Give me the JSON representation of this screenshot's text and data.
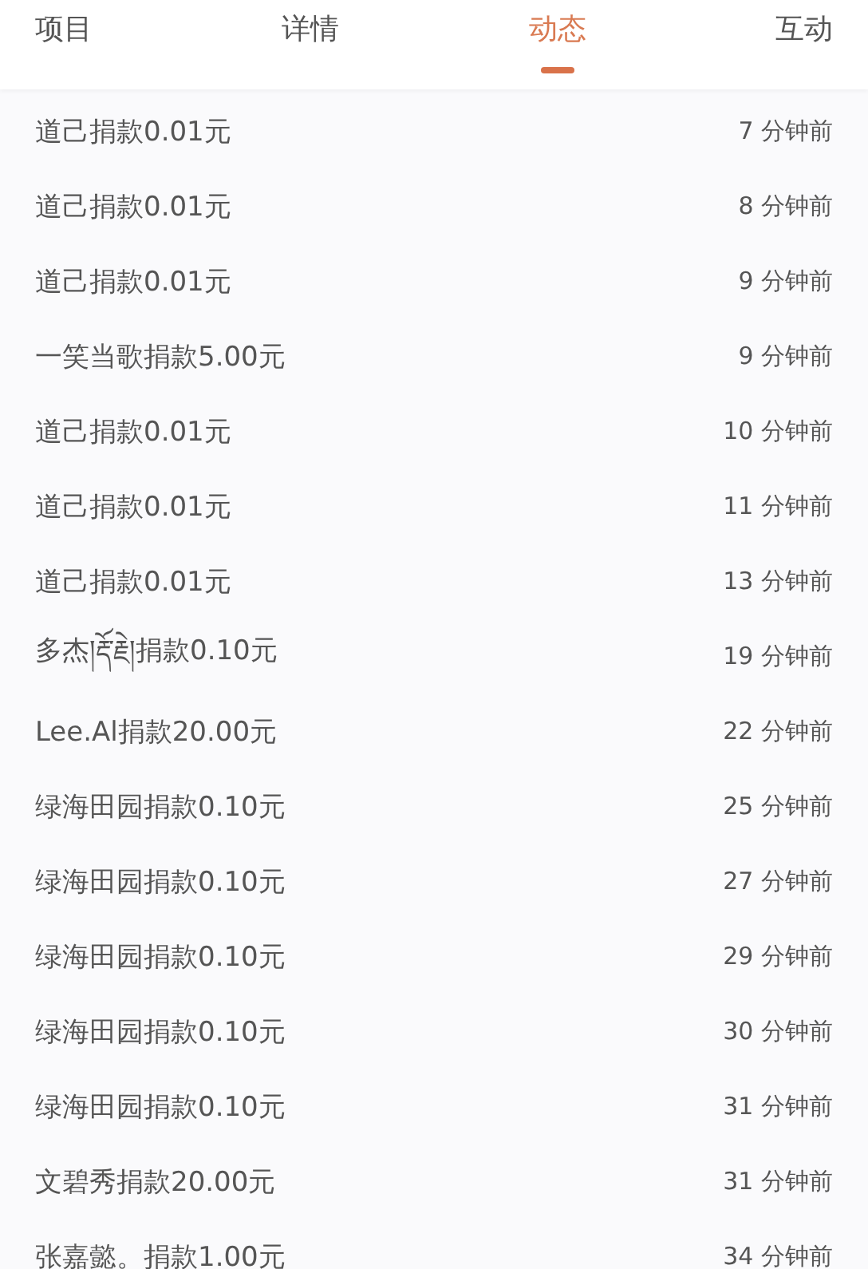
{
  "tabs": [
    {
      "label": "项目",
      "selected": false
    },
    {
      "label": "详情",
      "selected": false
    },
    {
      "label": "动态",
      "selected": true
    },
    {
      "label": "互动",
      "selected": false
    }
  ],
  "feed": [
    {
      "text": "道己捐款0.01元",
      "time": "7 分钟前"
    },
    {
      "text": "道己捐款0.01元",
      "time": "8 分钟前"
    },
    {
      "text": "道己捐款0.01元",
      "time": "9 分钟前"
    },
    {
      "text": "一笑当歌捐款5.00元",
      "time": "9 分钟前"
    },
    {
      "text": "道己捐款0.01元",
      "time": "10 分钟前"
    },
    {
      "text": "道己捐款0.01元",
      "time": "11 分钟前"
    },
    {
      "text": "道己捐款0.01元",
      "time": "13 分钟前"
    },
    {
      "text": "多杰།རྡོ་རྗེ།捐款0.10元",
      "time": "19 分钟前"
    },
    {
      "text": "Lee.Al捐款20.00元",
      "time": "22 分钟前"
    },
    {
      "text": "绿海田园捐款0.10元",
      "time": "25 分钟前"
    },
    {
      "text": "绿海田园捐款0.10元",
      "time": "27 分钟前"
    },
    {
      "text": "绿海田园捐款0.10元",
      "time": "29 分钟前"
    },
    {
      "text": "绿海田园捐款0.10元",
      "time": "30 分钟前"
    },
    {
      "text": "绿海田园捐款0.10元",
      "time": "31 分钟前"
    },
    {
      "text": "文碧秀捐款20.00元",
      "time": "31 分钟前"
    },
    {
      "text": "张嘉懿。捐款1.00元",
      "time": "34 分钟前"
    }
  ]
}
